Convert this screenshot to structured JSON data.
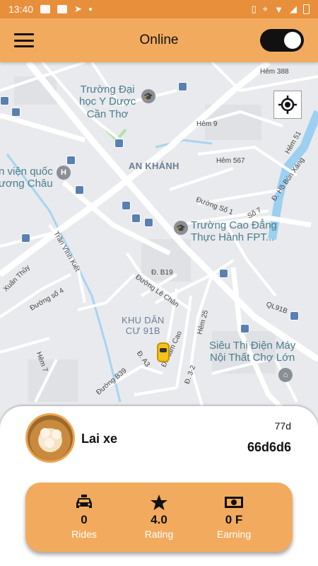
{
  "status_bar": {
    "time": "13:40"
  },
  "app_bar": {
    "title": "Online",
    "toggle_on": true
  },
  "map": {
    "labels": {
      "dai_hoc": "Trường Đại\nhọc Y Dược\nCần Thơ",
      "benh_vien": "n viện quốc\nương Châu",
      "an_khanh": "AN KHÁNH",
      "cao_dang": "Trường Cao Đẳng\nThực Hành FPT...",
      "khu_dan_cu": "KHU DÂN\nCƯ 91B",
      "sieu_thi": "Siêu Thị Điện Máy\nNội Thất Chợ Lớn",
      "hem_388": "Hẻm 388",
      "hem_9": "Hẻm 9",
      "hem_567": "Hẻm 567",
      "hem_51": "Hẻm 51",
      "ho_bun_xang": "Đ. Hồ Bún Xáng",
      "duong_so_1": "Đường Số 1",
      "so_7": "Số 7",
      "tran_vinh_kiet": "Trần Vĩnh Kiết",
      "xuan_thuy": "Xuân Thủy",
      "duong_so_4": "Đường số 4",
      "d_b19": "Đ. B19",
      "duong_le_chan": "Đường Lê Chân",
      "ql91b": "QL91B",
      "hem_25": "Hẻm 25",
      "nam_cao": "Đ. Nam Cao",
      "d_a3": "Đ. A3",
      "duong_b39": "Đường B39",
      "d_32": "Đ. 3-2",
      "hem_7": "Hẻm 7"
    }
  },
  "driver": {
    "name": "Lai xe",
    "time_ago": "77d",
    "plate": "66d6d6"
  },
  "stats": [
    {
      "icon": "taxi-icon",
      "value": "0",
      "label": "Rides"
    },
    {
      "icon": "star-icon",
      "value": "4.0",
      "label": "Rating"
    },
    {
      "icon": "cash-icon",
      "value": "0 F",
      "label": "Earning"
    }
  ]
}
